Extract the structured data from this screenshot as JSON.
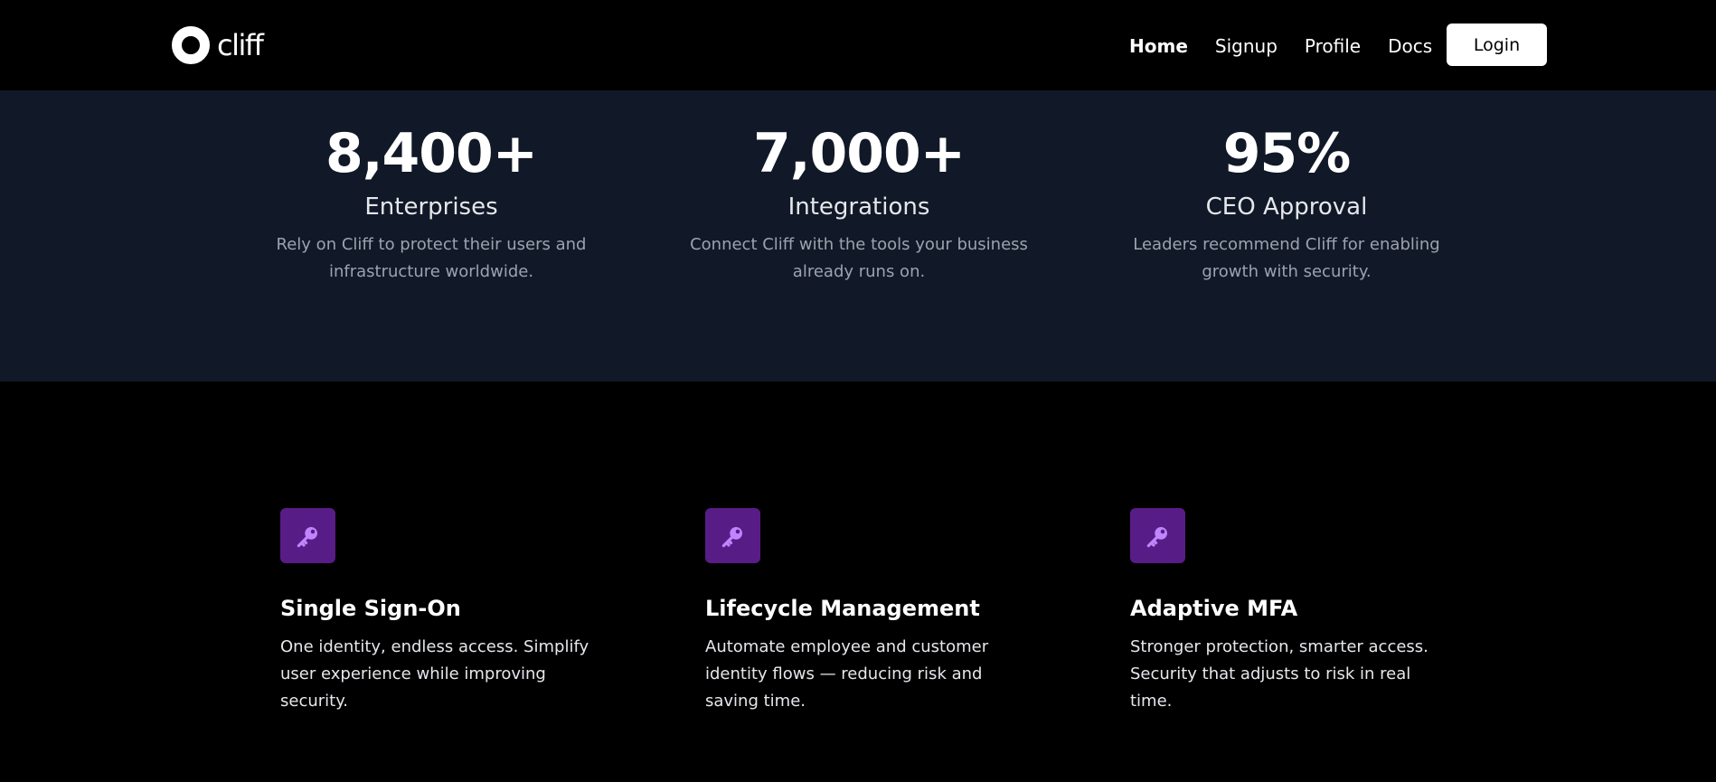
{
  "brand": {
    "name": "cliff"
  },
  "nav": {
    "links": [
      "Home",
      "Signup",
      "Profile",
      "Docs"
    ],
    "active": "Home",
    "login_label": "Login"
  },
  "stats": [
    {
      "value": "8,400+",
      "label": "Enterprises",
      "description": "Rely on Cliff to protect their users and infrastructure worldwide."
    },
    {
      "value": "7,000+",
      "label": "Integrations",
      "description": "Connect Cliff with the tools your business already runs on."
    },
    {
      "value": "95%",
      "label": "CEO Approval",
      "description": "Leaders recommend Cliff for enabling growth with security."
    }
  ],
  "features": [
    {
      "icon": "key-icon",
      "title": "Single Sign-On",
      "description": "One identity, endless access. Simplify user experience while improving security."
    },
    {
      "icon": "key-icon",
      "title": "Lifecycle Management",
      "description": "Automate employee and customer identity flows — reducing risk and saving time."
    },
    {
      "icon": "key-icon",
      "title": "Adaptive MFA",
      "description": "Stronger protection, smarter access. Security that adjusts to risk in real time."
    }
  ],
  "colors": {
    "background": "#000000",
    "stats_band": "#111827",
    "icon_tile": "#581c87",
    "icon_glyph": "#c084fc",
    "muted_text": "#9ca3af"
  }
}
